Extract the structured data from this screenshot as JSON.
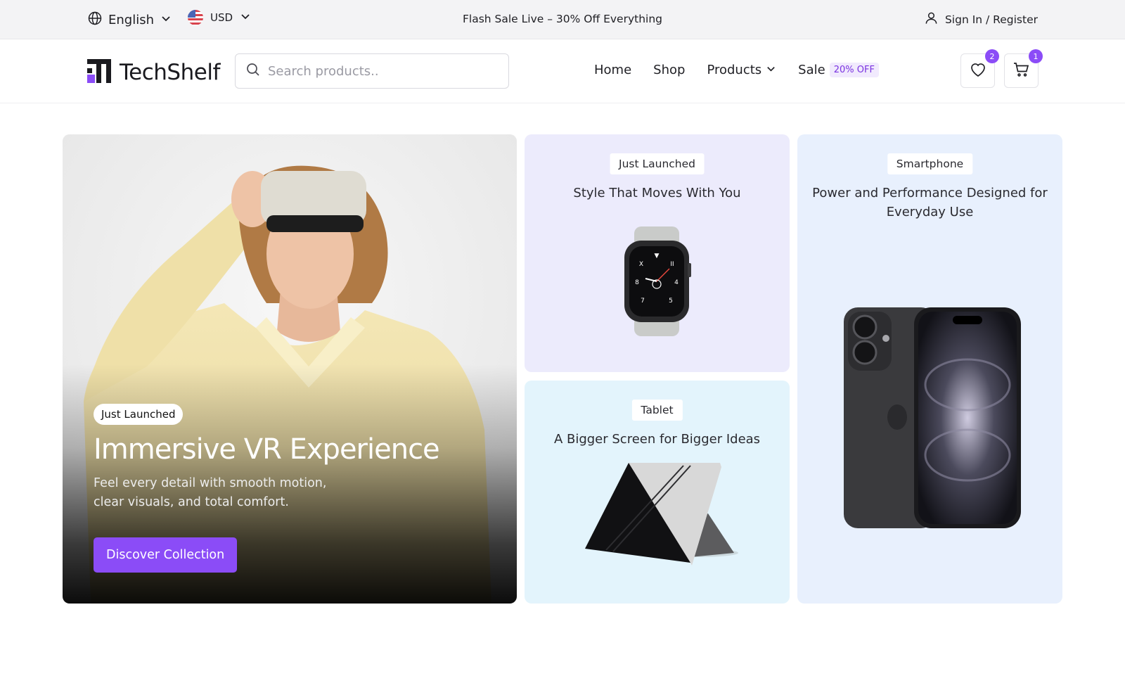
{
  "topbar": {
    "language": "English",
    "currency": "USD",
    "promo": "Flash Sale Live – 30% Off Everything",
    "signin": "Sign In / Register"
  },
  "header": {
    "brand": "TechShelf",
    "search_placeholder": "Search products..",
    "nav": {
      "home": "Home",
      "shop": "Shop",
      "products": "Products",
      "sale": "Sale",
      "sale_badge": "20% OFF"
    },
    "wishlist_count": "2",
    "cart_count": "1"
  },
  "hero": {
    "badge": "Just Launched",
    "title": "Immersive VR Experience",
    "description": "Feel every detail with smooth motion, clear visuals, and total comfort.",
    "cta": "Discover Collection"
  },
  "cards": {
    "watch": {
      "tag": "Just Launched",
      "caption": "Style That Moves With You"
    },
    "tablet": {
      "tag": "Tablet",
      "caption": "A Bigger Screen for Bigger Ideas"
    },
    "phone": {
      "tag": "Smartphone",
      "caption": "Power and Performance Designed for Everyday Use"
    }
  },
  "colors": {
    "accent": "#8b4cf7",
    "topbar_bg": "#f3f3f5",
    "watch_card_bg": "#ecebfc",
    "tablet_card_bg": "#e3f4fc",
    "phone_card_bg": "#e8f0fd"
  },
  "icons": [
    "globe-icon",
    "chevron-down-icon",
    "us-flag-icon",
    "user-icon",
    "search-icon",
    "heart-icon",
    "cart-icon"
  ]
}
